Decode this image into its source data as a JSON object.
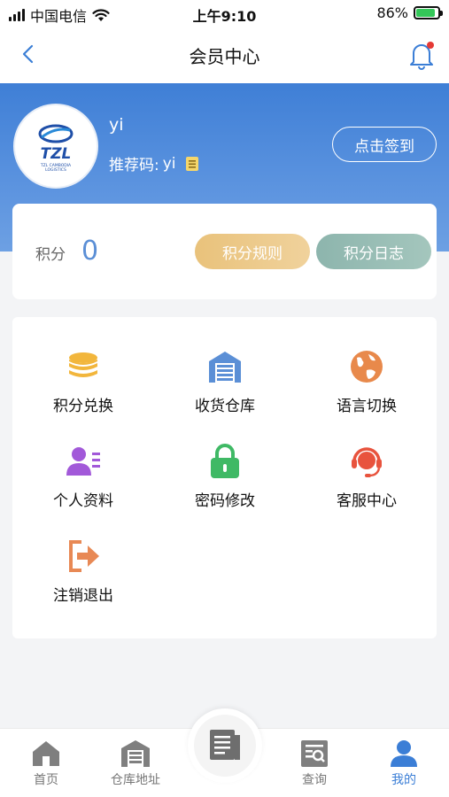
{
  "status_bar": {
    "carrier": "中国电信",
    "time": "上午9:10",
    "battery": "86%",
    "battery_level": 0.86
  },
  "nav": {
    "title": "会员中心"
  },
  "profile": {
    "username": "yi",
    "referral_label": "推荐码:",
    "referral_code": "yi",
    "checkin_label": "点击签到",
    "avatar_logo_text": "TZL",
    "avatar_logo_subtext": "TZL CAMBODIA LOGISTICS"
  },
  "points": {
    "label": "积分",
    "value": "0",
    "rules_label": "积分规则",
    "log_label": "积分日志"
  },
  "menu": {
    "items": [
      {
        "label": "积分兑换",
        "icon": "coins-stack-icon",
        "color": "#f2b63c"
      },
      {
        "label": "收货仓库",
        "icon": "warehouse-icon",
        "color": "#5b8fd6"
      },
      {
        "label": "语言切换",
        "icon": "globe-icon",
        "color": "#e8894b"
      },
      {
        "label": "个人资料",
        "icon": "profile-card-icon",
        "color": "#a259d9"
      },
      {
        "label": "密码修改",
        "icon": "lock-icon",
        "color": "#3fb965"
      },
      {
        "label": "客服中心",
        "icon": "headset-icon",
        "color": "#e8533d"
      },
      {
        "label": "注销退出",
        "icon": "logout-icon",
        "color": "#e88955"
      }
    ]
  },
  "tabs": [
    {
      "label": "首页",
      "icon": "home-icon",
      "active": false
    },
    {
      "label": "仓库地址",
      "icon": "warehouse-icon",
      "active": false
    },
    {
      "label": "查询",
      "icon": "search-doc-icon",
      "active": false
    },
    {
      "label": "我的",
      "icon": "user-icon",
      "active": true
    }
  ],
  "colors": {
    "accent": "#3b7ed6",
    "header_top": "#3f7fd6",
    "rules_button": "#e9c27b",
    "log_button": "#8db5ad"
  }
}
